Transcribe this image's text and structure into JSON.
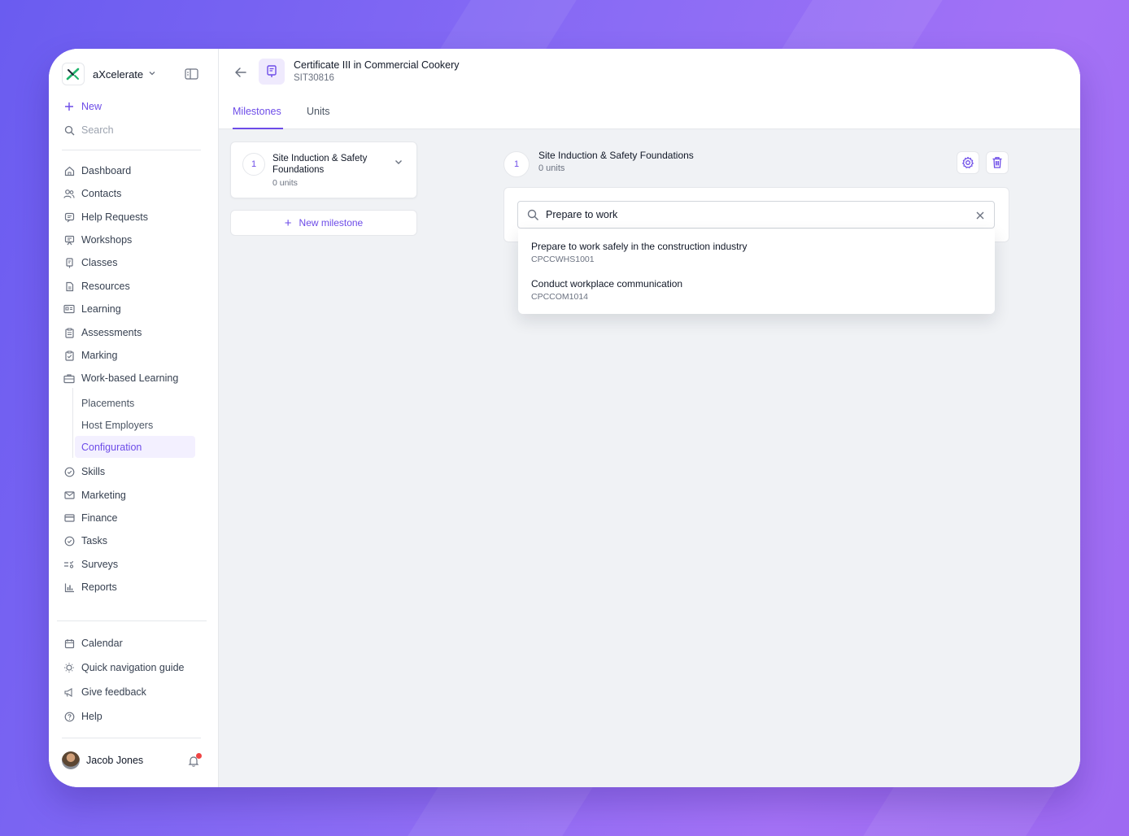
{
  "brand": {
    "name": "aXcelerate"
  },
  "sidebar": {
    "new_label": "New",
    "search_label": "Search",
    "items": [
      {
        "label": "Dashboard",
        "icon": "home-icon"
      },
      {
        "label": "Contacts",
        "icon": "users-icon"
      },
      {
        "label": "Help Requests",
        "icon": "help-requests-icon"
      },
      {
        "label": "Workshops",
        "icon": "workshops-icon"
      },
      {
        "label": "Classes",
        "icon": "classes-icon"
      },
      {
        "label": "Resources",
        "icon": "document-icon"
      },
      {
        "label": "Learning",
        "icon": "learning-icon"
      },
      {
        "label": "Assessments",
        "icon": "clipboard-icon"
      },
      {
        "label": "Marking",
        "icon": "marking-icon"
      },
      {
        "label": "Work-based Learning",
        "icon": "briefcase-icon"
      }
    ],
    "sub_items": [
      {
        "label": "Placements"
      },
      {
        "label": "Host Employers"
      },
      {
        "label": "Configuration"
      }
    ],
    "items2": [
      {
        "label": "Skills",
        "icon": "badge-check-icon"
      },
      {
        "label": "Marketing",
        "icon": "mail-icon"
      },
      {
        "label": "Finance",
        "icon": "credit-card-icon"
      },
      {
        "label": "Tasks",
        "icon": "check-circle-icon"
      },
      {
        "label": "Surveys",
        "icon": "surveys-icon"
      },
      {
        "label": "Reports",
        "icon": "bar-chart-icon"
      }
    ],
    "bottom_items": [
      {
        "label": "Calendar",
        "icon": "calendar-icon"
      },
      {
        "label": "Quick navigation guide",
        "icon": "lightbulb-icon"
      },
      {
        "label": "Give feedback",
        "icon": "megaphone-icon"
      },
      {
        "label": "Help",
        "icon": "question-icon"
      }
    ],
    "user": {
      "name": "Jacob Jones"
    }
  },
  "header": {
    "course_title": "Certificate III in Commercial Cookery",
    "course_code": "SIT30816",
    "tabs": [
      {
        "label": "Milestones"
      },
      {
        "label": "Units"
      }
    ]
  },
  "milestones": [
    {
      "number": "1",
      "title": "Site Induction & Safety Foundations",
      "units": "0 units"
    }
  ],
  "new_milestone_label": "New milestone",
  "detail": {
    "number": "1",
    "title": "Site Induction & Safety Foundations",
    "units": "0 units",
    "search_value": "Prepare to work",
    "results": [
      {
        "title": "Prepare to work safely in the construction industry",
        "code": "CPCCWHS1001"
      },
      {
        "title": "Conduct workplace communication",
        "code": "CPCCOM1014"
      }
    ]
  },
  "colors": {
    "accent": "#6d4ce8",
    "brand_green": "#1fb36b",
    "alert": "#ef4444"
  }
}
